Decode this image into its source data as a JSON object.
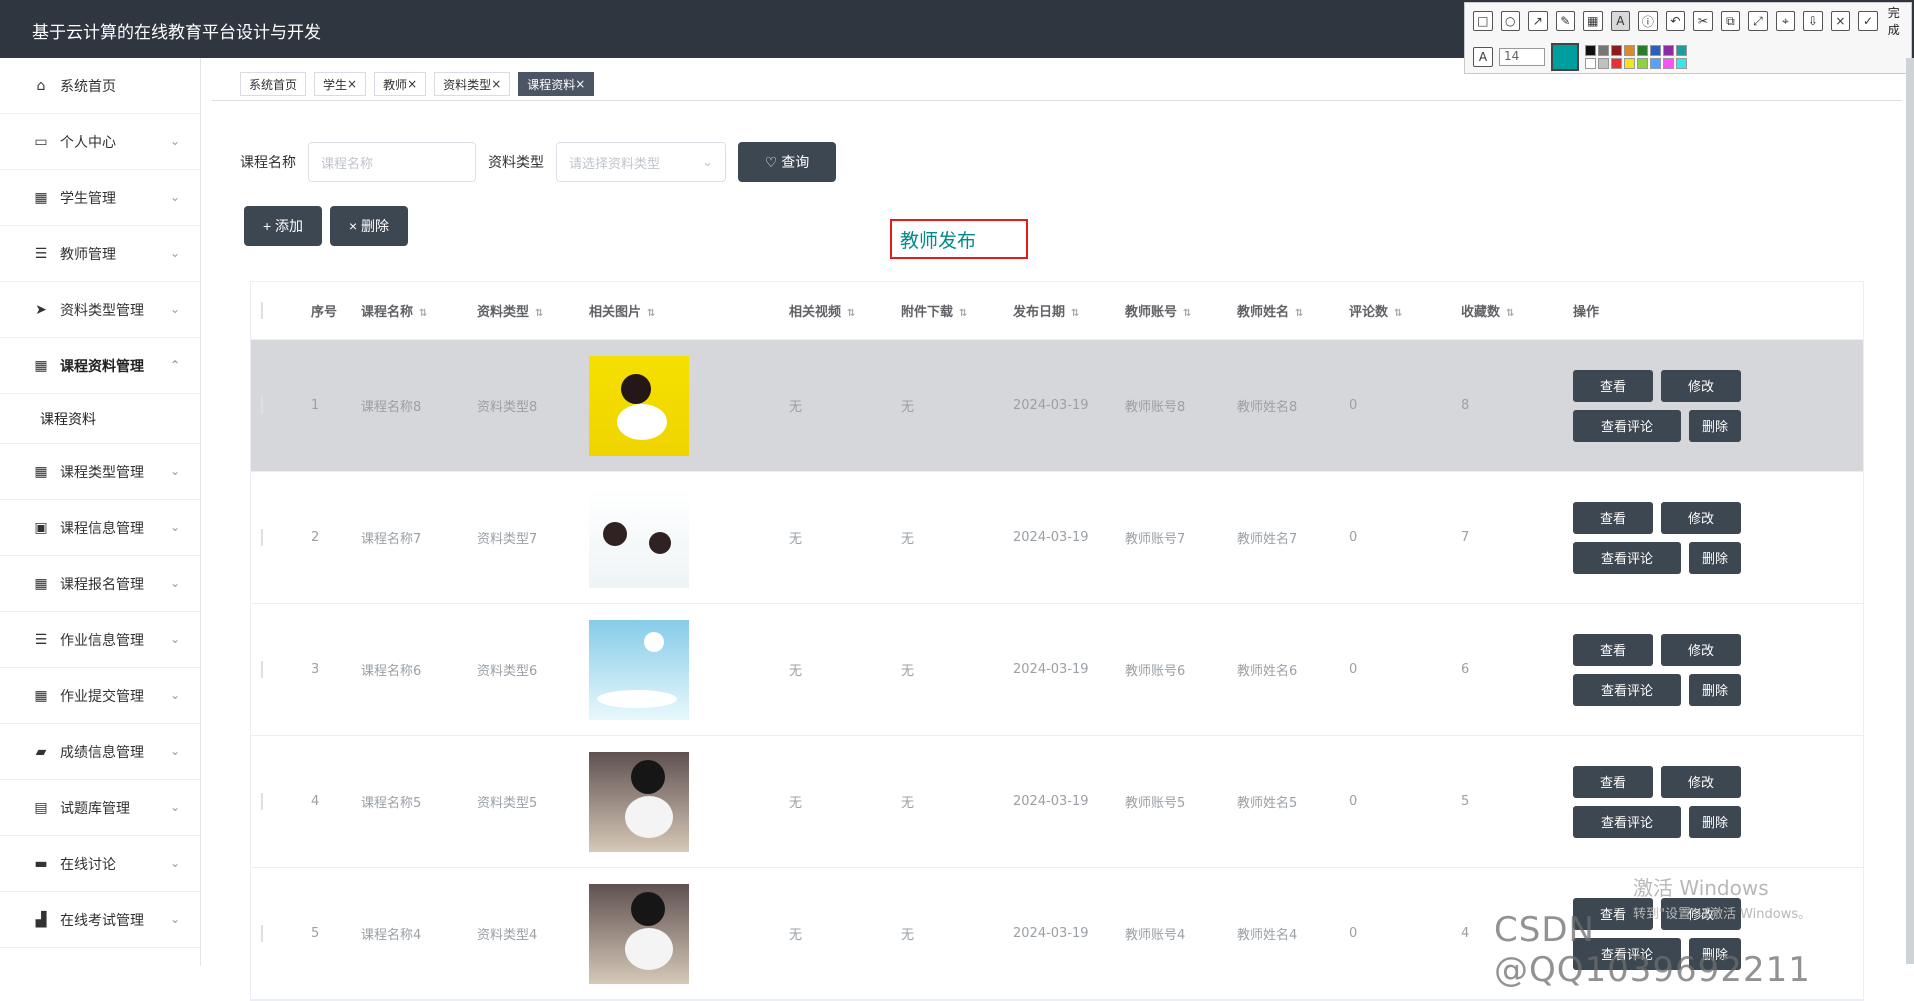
{
  "header": {
    "title": "基于云计算的在线教育平台设计与开发"
  },
  "toolbar": {
    "font_size": "14",
    "done_label": "完成"
  },
  "sidebar": {
    "items": [
      {
        "label": "系统首页",
        "icon": "home-icon"
      },
      {
        "label": "个人中心",
        "icon": "card-icon"
      },
      {
        "label": "学生管理",
        "icon": "grid-icon"
      },
      {
        "label": "教师管理",
        "icon": "sliders-icon"
      },
      {
        "label": "资料类型管理",
        "icon": "send-icon"
      },
      {
        "label": "课程资料管理",
        "icon": "grid-icon"
      },
      {
        "label": "课程资料",
        "icon": ""
      },
      {
        "label": "课程类型管理",
        "icon": "grid-icon"
      },
      {
        "label": "课程信息管理",
        "icon": "clipboard-icon"
      },
      {
        "label": "课程报名管理",
        "icon": "grid-icon"
      },
      {
        "label": "作业信息管理",
        "icon": "list-icon"
      },
      {
        "label": "作业提交管理",
        "icon": "grid-icon"
      },
      {
        "label": "成绩信息管理",
        "icon": "chart-icon"
      },
      {
        "label": "试题库管理",
        "icon": "document-icon"
      },
      {
        "label": "在线讨论",
        "icon": "briefcase-icon"
      },
      {
        "label": "在线考试管理",
        "icon": "factory-icon"
      }
    ]
  },
  "tabs": [
    "系统首页",
    "学生",
    "教师",
    "资料类型",
    "课程资料"
  ],
  "search": {
    "course_label": "课程名称",
    "course_placeholder": "课程名称",
    "type_label": "资料类型",
    "type_placeholder": "请选择资料类型",
    "query_label": "查询"
  },
  "actions": {
    "add": "添加",
    "delete": "删除"
  },
  "annotation": {
    "text": "教师发布"
  },
  "table": {
    "headers": [
      "序号",
      "课程名称",
      "资料类型",
      "相关图片",
      "相关视频",
      "附件下载",
      "发布日期",
      "教师账号",
      "教师姓名",
      "评论数",
      "收藏数",
      "操作"
    ],
    "rows": [
      [
        "1",
        "课程名称8",
        "资料类型8",
        "无",
        "无",
        "2024-03-19",
        "教师账号8",
        "教师姓名8",
        "0",
        "8"
      ],
      [
        "2",
        "课程名称7",
        "资料类型7",
        "无",
        "无",
        "2024-03-19",
        "教师账号7",
        "教师姓名7",
        "0",
        "7"
      ],
      [
        "3",
        "课程名称6",
        "资料类型6",
        "无",
        "无",
        "2024-03-19",
        "教师账号6",
        "教师姓名6",
        "0",
        "6"
      ],
      [
        "4",
        "课程名称5",
        "资料类型5",
        "无",
        "无",
        "2024-03-19",
        "教师账号5",
        "教师姓名5",
        "0",
        "5"
      ],
      [
        "5",
        "课程名称4",
        "资料类型4",
        "无",
        "无",
        "2024-03-19",
        "教师账号4",
        "教师姓名4",
        "0",
        "4"
      ]
    ],
    "ops": [
      "查看",
      "修改",
      "查看评论",
      "删除"
    ]
  },
  "watermark": {
    "title": "激活 Windows",
    "subtitle": "转到\"设置\"以激活 Windows。"
  },
  "csdn": "CSDN @QQ1039692211"
}
